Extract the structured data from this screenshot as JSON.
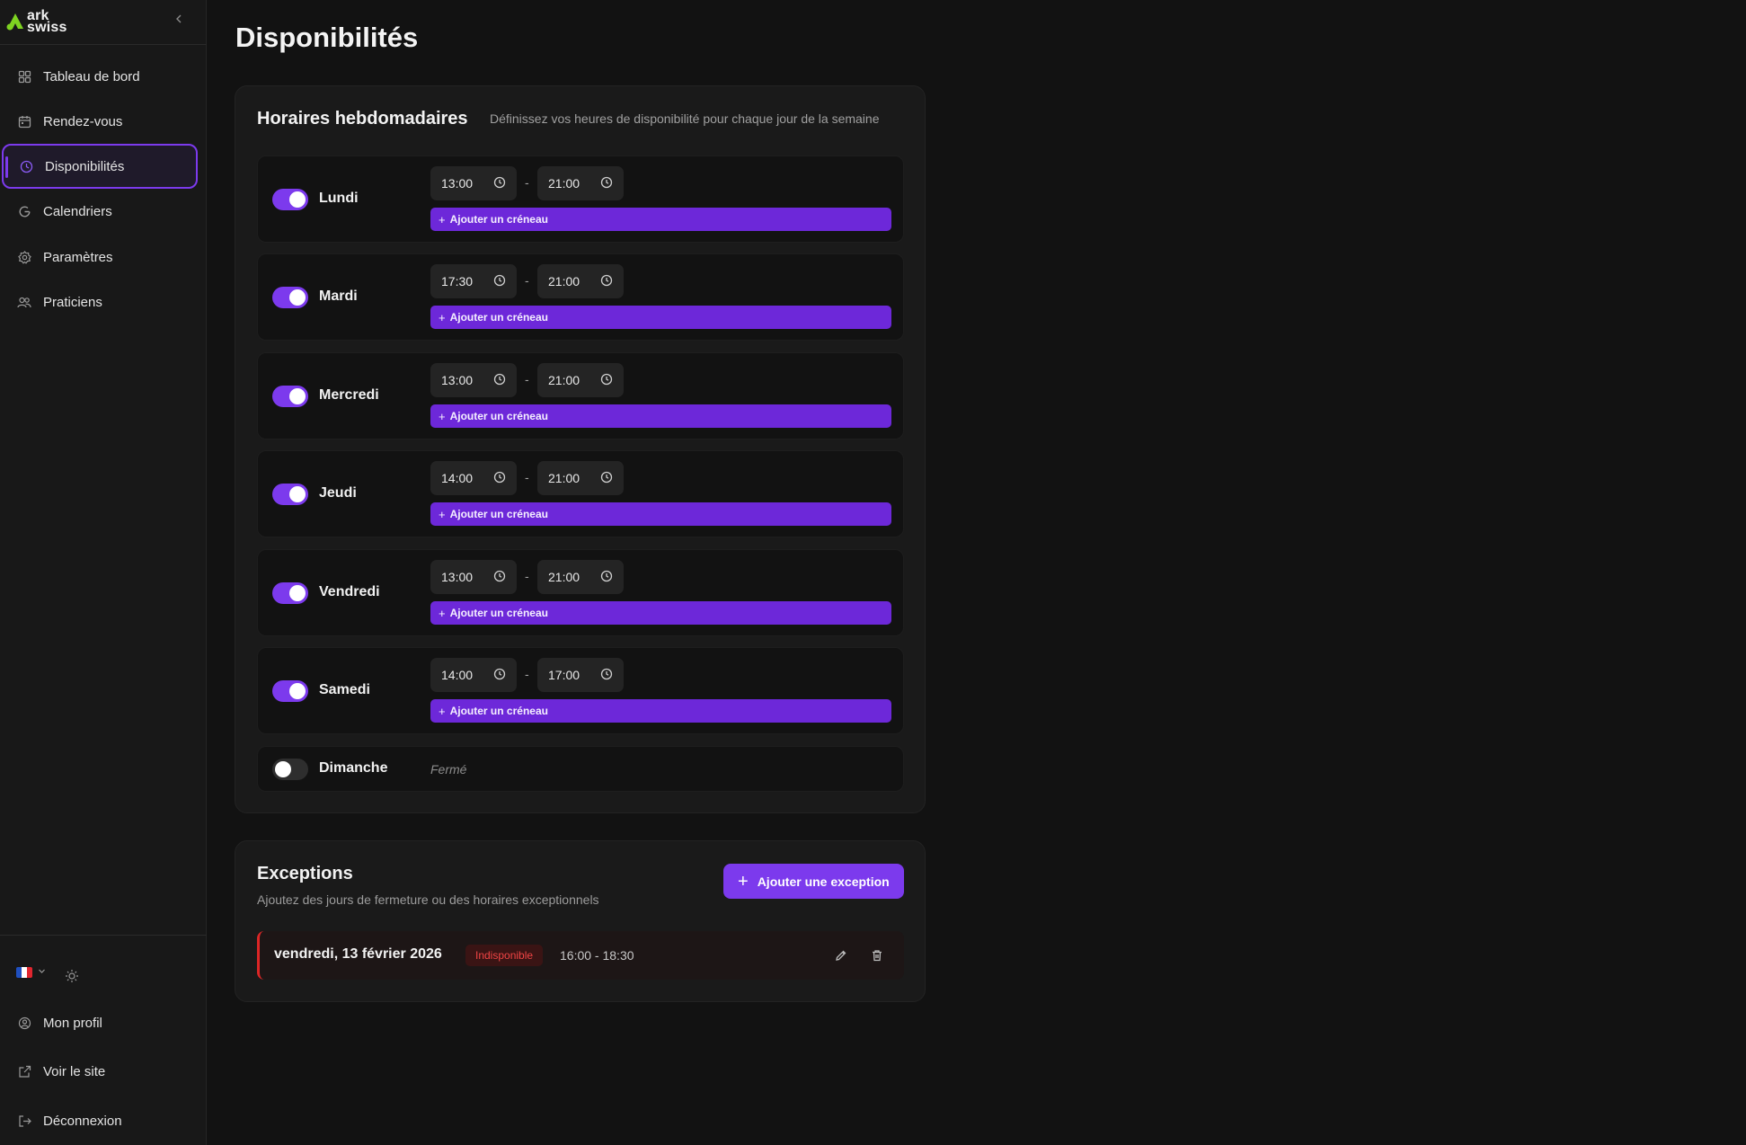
{
  "brand": {
    "line1": "ark",
    "line2": "swiss"
  },
  "sidebar": {
    "nav": [
      {
        "label": "Tableau de bord",
        "icon": "dashboard-icon"
      },
      {
        "label": "Rendez-vous",
        "icon": "calendar-icon"
      },
      {
        "label": "Disponibilités",
        "icon": "clock-icon",
        "active": true
      },
      {
        "label": "Calendriers",
        "icon": "google-icon"
      },
      {
        "label": "Paramètres",
        "icon": "gear-icon"
      },
      {
        "label": "Praticiens",
        "icon": "users-icon"
      }
    ],
    "language": "fr",
    "bottom": [
      {
        "label": "Mon profil",
        "icon": "user-circle-icon"
      },
      {
        "label": "Voir le site",
        "icon": "external-link-icon"
      },
      {
        "label": "Déconnexion",
        "icon": "logout-icon"
      }
    ]
  },
  "page": {
    "title": "Disponibilités"
  },
  "weekly": {
    "title": "Horaires hebdomadaires",
    "description": "Définissez vos heures de disponibilité pour chaque jour de la semaine",
    "add_slot_label": "Ajouter un créneau",
    "closed_label": "Fermé",
    "days": [
      {
        "name": "Lundi",
        "enabled": true,
        "start": "13:00",
        "end": "21:00"
      },
      {
        "name": "Mardi",
        "enabled": true,
        "start": "17:30",
        "end": "21:00"
      },
      {
        "name": "Mercredi",
        "enabled": true,
        "start": "13:00",
        "end": "21:00"
      },
      {
        "name": "Jeudi",
        "enabled": true,
        "start": "14:00",
        "end": "21:00"
      },
      {
        "name": "Vendredi",
        "enabled": true,
        "start": "13:00",
        "end": "21:00"
      },
      {
        "name": "Samedi",
        "enabled": true,
        "start": "14:00",
        "end": "17:00"
      },
      {
        "name": "Dimanche",
        "enabled": false
      }
    ]
  },
  "exceptions": {
    "title": "Exceptions",
    "description": "Ajoutez des jours de fermeture ou des horaires exceptionnels",
    "add_label": "Ajouter une exception",
    "items": [
      {
        "date": "vendredi, 13 février 2026",
        "status": "Indisponible",
        "time": "16:00 - 18:30"
      }
    ]
  },
  "colors": {
    "accent": "#7c3aed",
    "slot_button": "#6d28d9",
    "danger": "#dc2626",
    "background": "#121212"
  }
}
